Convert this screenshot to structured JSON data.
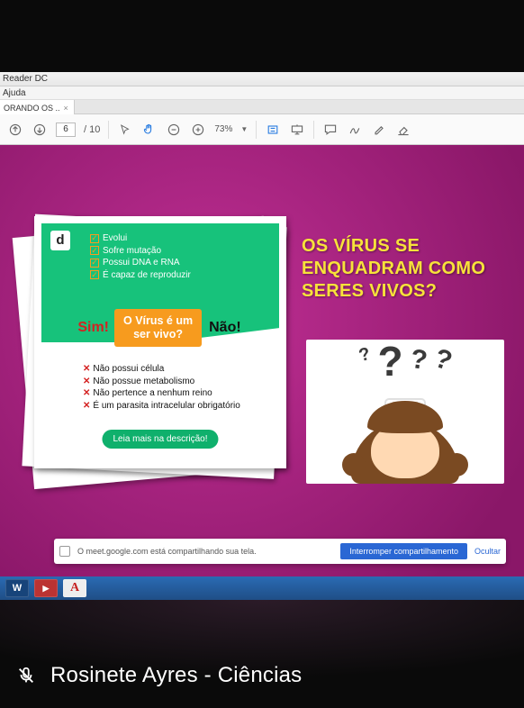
{
  "reader": {
    "app_title": "Reader DC",
    "menu_help": "Ajuda",
    "tab_label": "ORANDO OS ..",
    "page_current": "6",
    "page_total": "10",
    "zoom": "73%"
  },
  "slide": {
    "d_badge": "d",
    "green": {
      "i1": "Evolui",
      "i2": "Sofre mutação",
      "i3": "Possui DNA e RNA",
      "i4": "É capaz de reproduzir"
    },
    "sim": "Sim!",
    "nao": "Não!",
    "orange_l1": "O Vírus é um",
    "orange_l2": "ser vivo?",
    "red": {
      "i1": "Não possui célula",
      "i2": "Não possue metabolismo",
      "i3": "Não pertence a nenhum reino",
      "i4": "É um parasita intracelular obrigatório"
    },
    "cta": "Leia mais na descrição!",
    "question_title": "OS VÍRUS SE ENQUADRAM COMO SERES VIVOS?"
  },
  "share": {
    "text": "O meet.google.com está compartilhando sua tela.",
    "stop": "Interromper compartilhamento",
    "hide": "Ocultar"
  },
  "caption": {
    "text": "Rosinete Ayres - Ciências"
  }
}
